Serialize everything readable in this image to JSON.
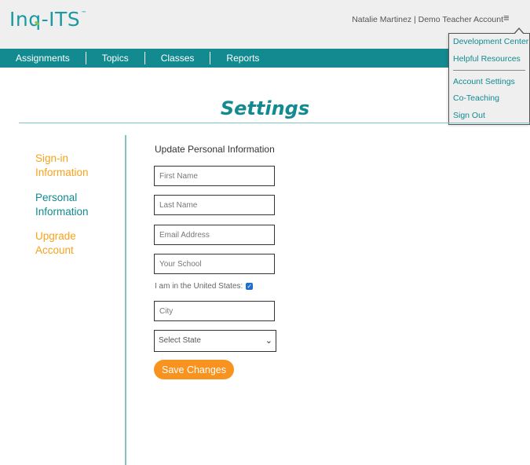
{
  "header": {
    "logo_prefix": "In",
    "logo_q": "q",
    "logo_suffix": "-ITS",
    "logo_tm": "™",
    "user": "Natalie Martinez | Demo Teacher Account",
    "menu_icon": "hamburger-icon"
  },
  "nav": {
    "items": [
      "Assignments",
      "Topics",
      "Classes",
      "Reports"
    ]
  },
  "dropdown": {
    "items": [
      "Development Center",
      "Helpful Resources",
      "Account Settings",
      "Co-Teaching",
      "Sign Out"
    ]
  },
  "page": {
    "title": "Settings"
  },
  "sidebar": {
    "items": [
      {
        "line1": "Sign-in",
        "line2": "Information"
      },
      {
        "line1": "Personal",
        "line2": "Information"
      },
      {
        "line1": "Upgrade",
        "line2": "Account"
      }
    ]
  },
  "form": {
    "heading": "Update Personal Information",
    "first_name_placeholder": "First Name",
    "last_name_placeholder": "Last Name",
    "email_placeholder": "Email Address",
    "school_placeholder": "Your School",
    "us_label": "I am in the United States:",
    "us_checked": "✓",
    "city_placeholder": "City",
    "state_placeholder": "Select State",
    "state_chevron": "⌄",
    "save_label": "Save Changes"
  },
  "colors": {
    "brand_teal": "#128a90",
    "accent_orange": "#f7931e",
    "link_orange": "#f7a21b"
  }
}
